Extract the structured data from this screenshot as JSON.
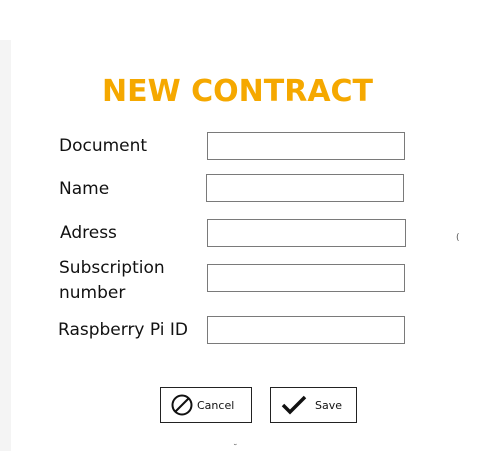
{
  "form": {
    "title": "NEW CONTRACT",
    "title_color": "#f5a800",
    "fields": [
      {
        "label": "Document",
        "value": ""
      },
      {
        "label": "Name",
        "value": ""
      },
      {
        "label": "Adress",
        "value": ""
      },
      {
        "label": "Subscription number",
        "value": ""
      },
      {
        "label": "Raspberry Pi ID",
        "value": ""
      }
    ]
  },
  "actions": {
    "cancel_label": "Cancel",
    "cancel_icon": "cancel-circle-icon",
    "save_label": "Save",
    "save_icon": "checkmark-icon"
  }
}
